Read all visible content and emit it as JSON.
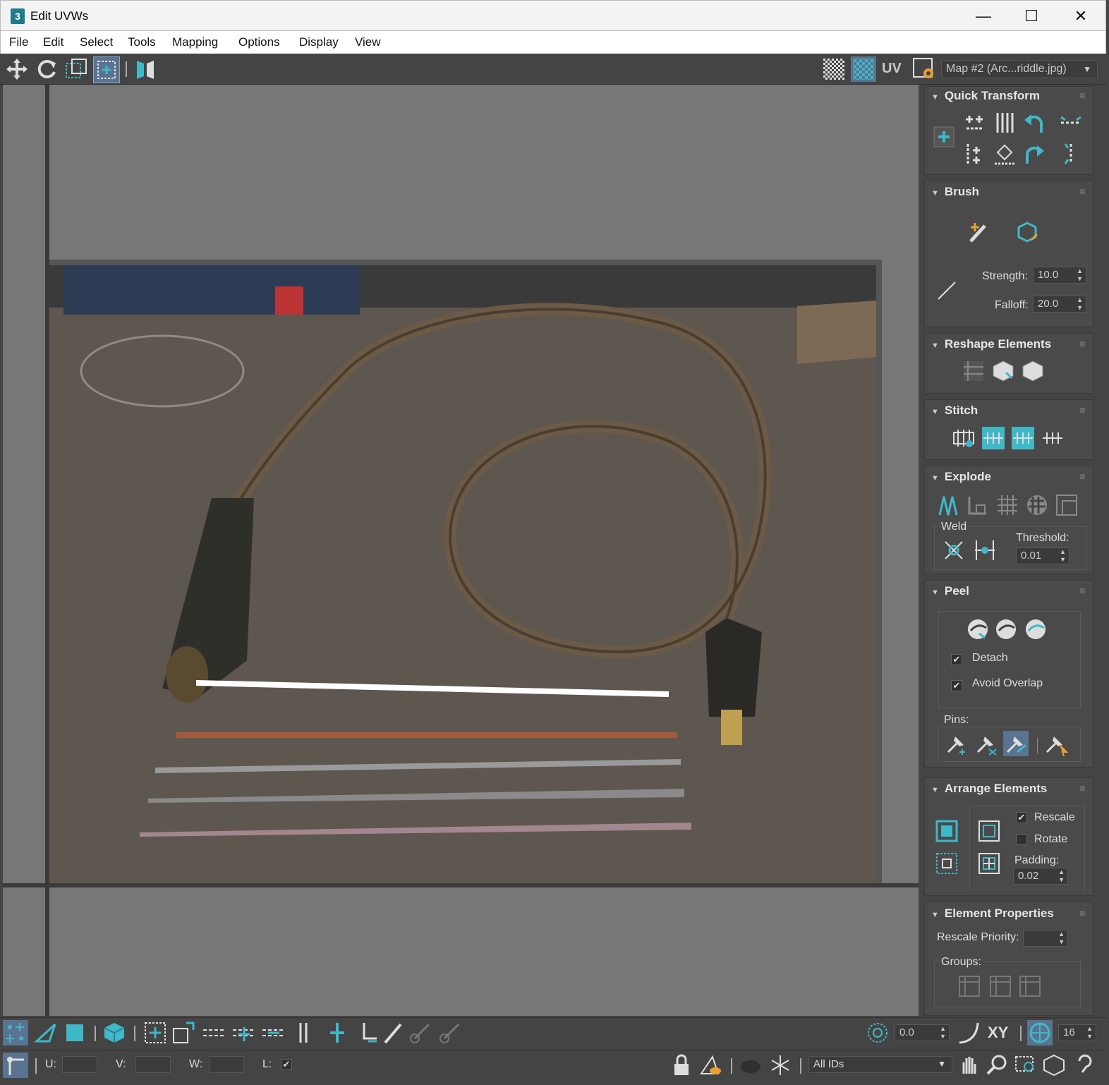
{
  "window": {
    "title": "Edit UVWs",
    "app_icon_text": "3",
    "minimize_symbol": "—",
    "maximize_symbol": "☐",
    "close_symbol": "✕"
  },
  "menu": [
    "File",
    "Edit",
    "Select",
    "Tools",
    "Mapping",
    "Options",
    "Display",
    "View"
  ],
  "toolbar": {
    "uv_label": "UV",
    "map_select": "Map #2 (Arc...riddle.jpg)",
    "icons": [
      "move-icon",
      "rotate-icon",
      "scale-icon",
      "freeform-icon",
      "mirror-icon",
      "checker-icon",
      "checker-teal-icon",
      "settings-icon"
    ]
  },
  "panel": {
    "quick_transform": {
      "title": "Quick Transform"
    },
    "brush": {
      "title": "Brush",
      "strength_label": "Strength:",
      "strength_value": "10.0",
      "falloff_label": "Falloff:",
      "falloff_value": "20.0"
    },
    "reshape": {
      "title": "Reshape Elements"
    },
    "stitch": {
      "title": "Stitch"
    },
    "explode": {
      "title": "Explode",
      "weld_label": "Weld",
      "threshold_label": "Threshold:",
      "threshold_value": "0.01"
    },
    "peel": {
      "title": "Peel",
      "detach_label": "Detach",
      "detach_checked": true,
      "avoid_overlap_label": "Avoid Overlap",
      "avoid_overlap_checked": true,
      "pins_label": "Pins:"
    },
    "arrange": {
      "title": "Arrange Elements",
      "rescale_label": "Rescale",
      "rescale_checked": true,
      "rotate_label": "Rotate",
      "rotate_checked": false,
      "padding_label": "Padding:",
      "padding_value": "0.02"
    },
    "element_props": {
      "title": "Element Properties",
      "rescale_priority_label": "Rescale Priority:",
      "groups_label": "Groups:"
    }
  },
  "bottom": {
    "angle_value": "0.0",
    "xy_label": "XY",
    "grid_value": "16",
    "u_label": "U:",
    "v_label": "V:",
    "w_label": "W:",
    "l_label": "L:",
    "ids_select": "All IDs"
  },
  "colors": {
    "accent": "#3fb8c8",
    "panel_bg": "#444444",
    "viewport_bg": "#777777"
  }
}
